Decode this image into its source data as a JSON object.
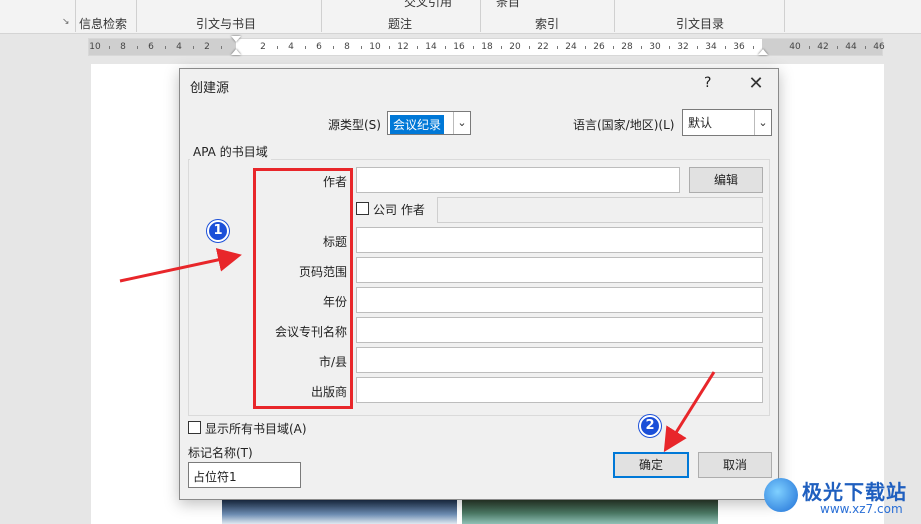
{
  "ribbon": {
    "labels": [
      "信息检索",
      "引文与书目",
      "题注",
      "索引",
      "引文目录"
    ],
    "partial_top": [
      "交叉引用",
      "条目"
    ]
  },
  "ruler": {
    "numbers": [
      "10",
      "8",
      "6",
      "4",
      "2",
      "2",
      "4",
      "6",
      "8",
      "10",
      "12",
      "14",
      "16",
      "18",
      "20",
      "22",
      "24",
      "26",
      "28",
      "30",
      "32",
      "34",
      "36",
      "40",
      "42",
      "44",
      "46"
    ]
  },
  "dialog": {
    "title": "创建源",
    "help": "?",
    "close": "✕",
    "source_type_label": "源类型(S)",
    "source_type_value": "会议纪录",
    "language_label": "语言(国家/地区)(L)",
    "language_value": "默认",
    "group_title": "APA 的书目域",
    "fields": [
      {
        "label": "作者",
        "value": ""
      },
      {
        "label": "标题",
        "value": ""
      },
      {
        "label": "页码范围",
        "value": ""
      },
      {
        "label": "年份",
        "value": ""
      },
      {
        "label": "会议专刊名称",
        "value": ""
      },
      {
        "label": "市/县",
        "value": ""
      },
      {
        "label": "出版商",
        "value": ""
      }
    ],
    "edit_button": "编辑",
    "corporate_checkbox_label": "公司 作者",
    "corporate_checked": false,
    "show_all_label": "显示所有书目域(A)",
    "show_all_checked": false,
    "tag_name_label": "标记名称(T)",
    "tag_name_value": "占位符1",
    "ok_button": "确定",
    "cancel_button": "取消"
  },
  "annotations": {
    "badge1": "1",
    "badge2": "2",
    "highlight_color": "#e8262a",
    "badge_color": "#1b4fd8"
  },
  "watermark": {
    "text": "极光下载站",
    "url": "www.xz7.com"
  }
}
